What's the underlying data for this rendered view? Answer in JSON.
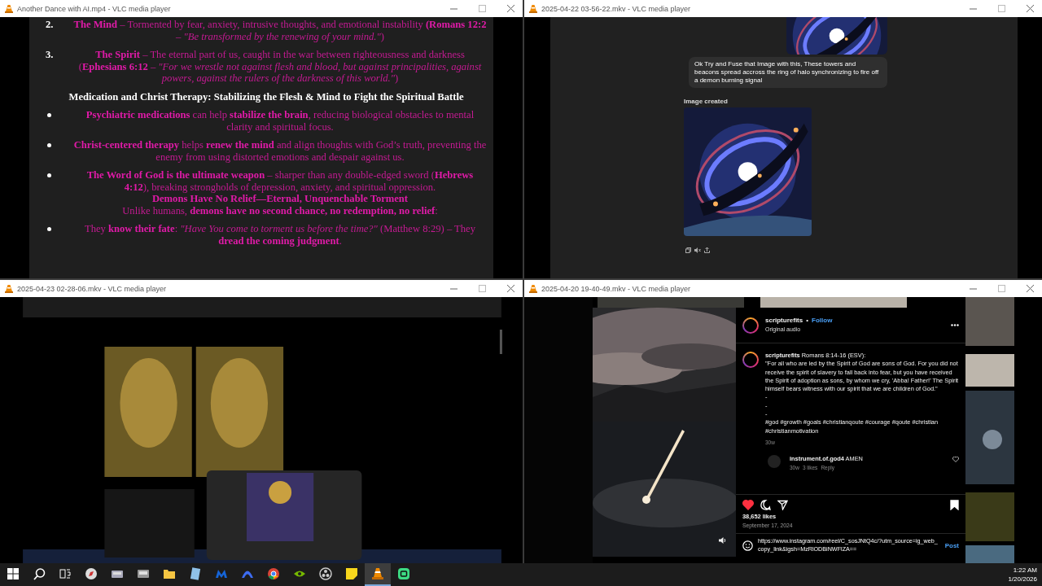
{
  "windows": [
    {
      "title": "Another Dance with AI.mp4 - VLC media player",
      "kind": "document",
      "document": [
        {
          "kind": "numbered",
          "number": "2.",
          "lines": [
            "**The Mind** – Tormented by fear, anxiety, intrusive thoughts, and emotional instability **(Romans 12:2** – *\"Be transformed by the renewing of your mind.\"*)"
          ]
        },
        {
          "kind": "numbered",
          "number": "3.",
          "lines": [
            "**The Spirit** – The eternal part of us, caught in the war between righteousness and darkness (**Ephesians 6:12** – *\"For we wrestle not against flesh and blood, but against principalities, against powers, against the rulers of the darkness of this world.\"*)"
          ]
        },
        {
          "kind": "heading",
          "lines": [
            "Medication and Christ Therapy: Stabilizing the Flesh & Mind to Fight the Spiritual Battle"
          ]
        },
        {
          "kind": "bullet",
          "lines": [
            "**Psychiatric medications** can help **stabilize the brain**, reducing biological obstacles to mental clarity and spiritual focus."
          ]
        },
        {
          "kind": "bullet",
          "lines": [
            "**Christ-centered therapy** helps **renew the mind** and align thoughts with God’s truth, preventing the enemy from using distorted emotions and despair against us."
          ]
        },
        {
          "kind": "bullet",
          "lines": [
            "**The Word of God is the ultimate weapon** – sharper than any double-edged sword (**Hebrews 4:12**), breaking strongholds of depression, anxiety, and spiritual oppression.",
            "**Demons Have No Relief—Eternal, Unquenchable Torment**",
            "Unlike humans, **demons have no second chance, no redemption, no relief**:"
          ]
        },
        {
          "kind": "bullet",
          "lines": [
            "They **know their fate**: *\"Have You come to torment us before the time?\"* (Matthew 8:29) – They **dread the coming judgment**."
          ]
        }
      ]
    },
    {
      "title": "2025-04-22 03-56-22.mkv - VLC media player",
      "kind": "chat",
      "chat": {
        "prompt": "Ok Try and Fuse that Image with this, These towers and beacons spread accross the ring of halo synchronizing to fire off a demon burning signal",
        "status": "Image created"
      }
    },
    {
      "title": "2025-04-23 02-28-06.mkv - VLC media player",
      "kind": "recording"
    },
    {
      "title": "2025-04-20 19-40-49.mkv - VLC media player",
      "kind": "post",
      "post": {
        "username": "scripturefits",
        "separator": "•",
        "follow": "Follow",
        "audio": "Original audio",
        "caption_title": "**scripturefits** Romans 8:14-16 (ESV):",
        "caption": "\"For all who are led by the Spirit of God are sons of God. For you did not receive the spirit of slavery to fall back into fear, but you have received the Spirit of adoption as sons, by whom we cry, 'Abba! Father!' The Spirit himself bears witness with our spirit that we are children of God.\"",
        "dashes": [
          "-",
          "-",
          "-"
        ],
        "hashtags": "#god #growth #goals #christianqoute #courage #qoute #christian #christianmotivation",
        "age": "30w",
        "comment": {
          "text": "**instrument.of.god4** AMEN",
          "age": "30w",
          "likes": "3 likes",
          "reply": "Reply"
        },
        "liked": true,
        "saved": true,
        "likes": "38,652 likes",
        "date": "September 17, 2024",
        "input": "https://www.instagram.com/reel/C_sosJNtQ4c/?utm_source=ig_web_copy_link&igsh=MzRlODBiNWFlZA==",
        "post_button": "Post"
      }
    }
  ],
  "taskbar": {
    "apps": [
      {
        "kind": "compass",
        "active": false
      },
      {
        "kind": "drive",
        "active": false
      },
      {
        "kind": "disk",
        "active": false
      },
      {
        "kind": "folder",
        "active": false
      },
      {
        "kind": "notes",
        "active": false
      },
      {
        "kind": "malware",
        "active": false
      },
      {
        "kind": "arch",
        "active": false
      },
      {
        "kind": "chrome",
        "active": false
      },
      {
        "kind": "nvidia",
        "active": false
      },
      {
        "kind": "obs",
        "active": false
      },
      {
        "kind": "sticky",
        "active": false
      },
      {
        "kind": "vlc",
        "active": true
      },
      {
        "kind": "green",
        "active": false
      }
    ],
    "time": "1:22 AM",
    "date": "1/20/2026"
  }
}
